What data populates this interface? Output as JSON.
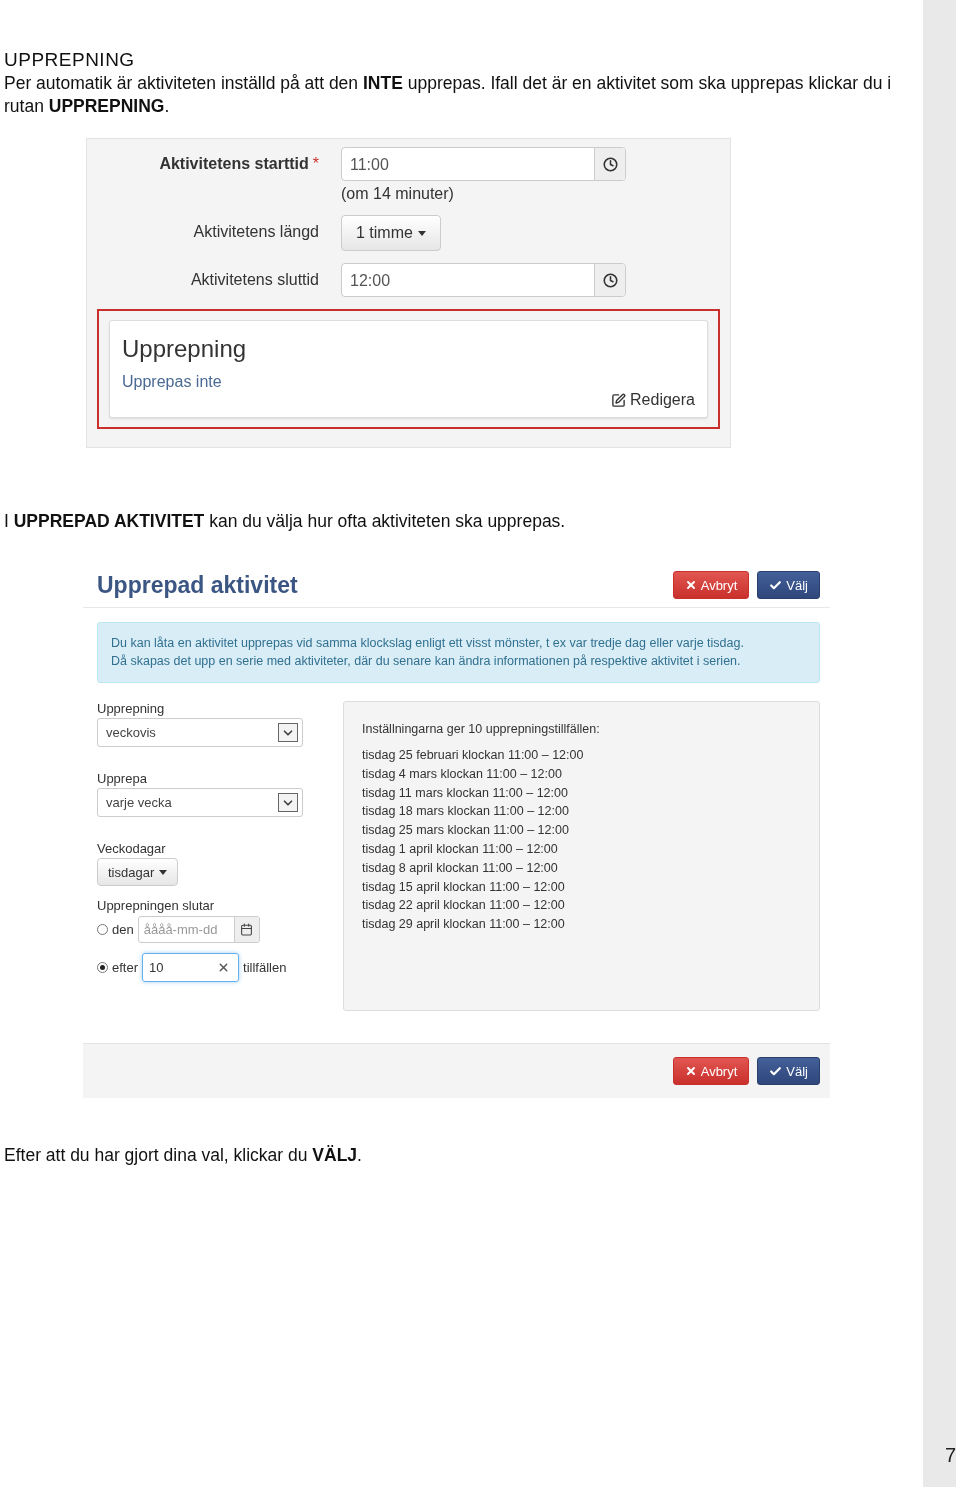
{
  "section_heading": "UPPREPNING",
  "intro": "Per automatik är aktiviteten inställd på att den **INTE** upprepas. Ifall det är en aktivitet som ska upprepas klickar du i rutan **UPPREPNING**.",
  "form_screenshot": {
    "fields": [
      {
        "kind": "time",
        "label": "Aktivitetens starttid",
        "required_mark": "*",
        "value": "11:00",
        "hint": "(om 14 minuter)"
      },
      {
        "kind": "dropdown",
        "label": "Aktivitetens längd",
        "value": "1 timme"
      },
      {
        "kind": "time",
        "label": "Aktivitetens sluttid",
        "value": "12:00"
      }
    ],
    "repeat_card": {
      "title": "Upprepning",
      "status": "Upprepas inte",
      "edit_link": "Redigera",
      "highlighted": true
    }
  },
  "paragraph_2": "I **UPPREPAD AKTIVITET** kan du välja hur ofta aktiviteten ska upprepas.",
  "dialog": {
    "title": "Upprepad aktivitet",
    "header_buttons": [
      {
        "kind": "cancel",
        "label": "Avbryt"
      },
      {
        "kind": "confirm",
        "label": "Välj"
      }
    ],
    "info": [
      "Du kan låta en aktivitet upprepas vid samma klockslag enligt ett visst mönster, t ex var tredje dag eller varje tisdag.",
      "Då skapas det upp en serie med aktiviteter, där du senare kan ändra informationen på respektive aktivitet i serien."
    ],
    "fields": [
      {
        "kind": "select",
        "label": "Upprepning",
        "value": "veckovis"
      },
      {
        "kind": "select",
        "label": "Upprepa",
        "value": "varje vecka"
      },
      {
        "kind": "dropdown",
        "label": "Veckodagar",
        "value": "tisdagar"
      }
    ],
    "end": {
      "label": "Upprepningen slutar",
      "options": [
        {
          "kind": "date",
          "label": "den",
          "selected": false,
          "placeholder": "åååå-mm-dd"
        },
        {
          "kind": "count",
          "label": "efter",
          "selected": true,
          "value": "10",
          "suffix": "tillfällen"
        }
      ]
    },
    "summary": {
      "heading": "Inställningarna ger 10 upprepningstillfällen:",
      "occurrences": [
        "tisdag 25 februari klockan 11:00 – 12:00",
        "tisdag 4 mars klockan 11:00 – 12:00",
        "tisdag 11 mars klockan 11:00 – 12:00",
        "tisdag 18 mars klockan 11:00 – 12:00",
        "tisdag 25 mars klockan 11:00 – 12:00",
        "tisdag 1 april klockan 11:00 – 12:00",
        "tisdag 8 april klockan 11:00 – 12:00",
        "tisdag 15 april klockan 11:00 – 12:00",
        "tisdag 22 april klockan 11:00 – 12:00",
        "tisdag 29 april klockan 11:00 – 12:00"
      ]
    },
    "footer_buttons": [
      {
        "kind": "cancel",
        "label": "Avbryt"
      },
      {
        "kind": "confirm",
        "label": "Välj"
      }
    ]
  },
  "paragraph_3": "Efter att du har gjort dina val, klickar du **VÄLJ**.",
  "page_number": "7"
}
